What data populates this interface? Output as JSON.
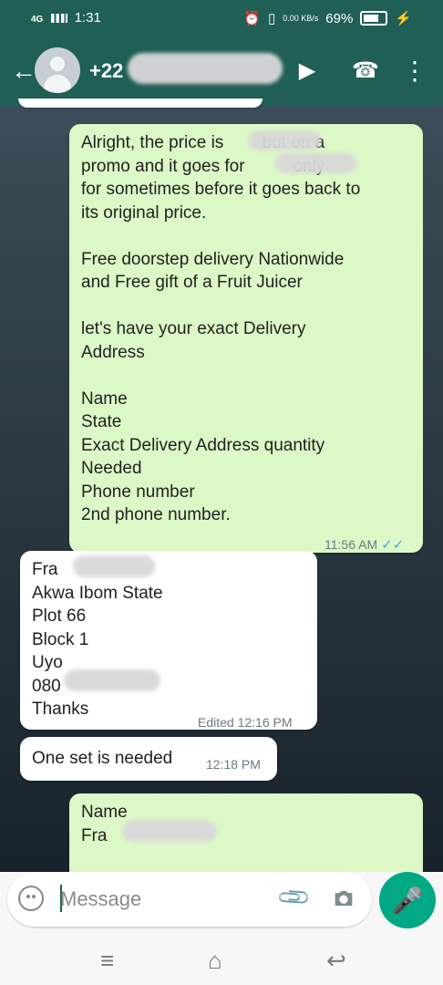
{
  "statusbar": {
    "network": "4G",
    "time": "1:31",
    "data_rate": "0.00 KB/s",
    "battery": "69%"
  },
  "header": {
    "contact": "+22",
    "video_icon": "video-icon",
    "call_icon": "phone-icon",
    "menu_icon": "more-vert-icon"
  },
  "messages": [
    {
      "type": "out",
      "text": "Alright, the price is        but on a\npromo and it goes for          only\nfor sometimes before it goes back to\nits original price.\n\nFree doorstep delivery Nationwide\nand Free gift of a Fruit Juicer\n\nlet's have your exact Delivery\nAddress\n\nName\nState\nExact Delivery Address quantity\nNeeded\nPhone number\n2nd phone number.",
      "time": "11:56 AM",
      "status": "read"
    },
    {
      "type": "in",
      "text": "Fra\nAkwa Ibom State\nPlot 66\nBlock 1\nUyo\n080\nThanks",
      "time": "Edited 12:16 PM"
    },
    {
      "type": "in",
      "text": "One set is needed",
      "time": "12:18 PM"
    },
    {
      "type": "out",
      "text": "Name\nFra",
      "time": ""
    }
  ],
  "composer": {
    "placeholder": "Message"
  },
  "navbar": {
    "menu": "≡",
    "home": "⌂",
    "back": "↩"
  }
}
